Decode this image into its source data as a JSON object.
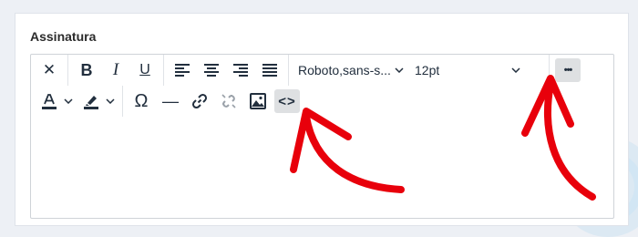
{
  "page": {
    "background_color": "#edf0f5"
  },
  "field": {
    "label": "Assinatura"
  },
  "toolbar": {
    "row1": {
      "clear_formatting": "✕",
      "bold": "B",
      "italic": "I",
      "underline": "U",
      "font_family": "Roboto,sans-s...",
      "font_size": "12pt",
      "more": "•••"
    },
    "row2": {
      "special_char": "Ω",
      "horizontal_line": "—",
      "source_code": "<>"
    }
  },
  "annotation": {
    "arrow_color": "#e8000b"
  },
  "icons": [
    "close-icon",
    "bold-icon",
    "italic-icon",
    "underline-icon",
    "align-left-icon",
    "align-center-icon",
    "align-right-icon",
    "align-justify-icon",
    "chevron-down-icon",
    "more-icon",
    "text-color-icon",
    "highlight-icon",
    "omega-icon",
    "horizontal-line-icon",
    "link-icon",
    "unlink-icon",
    "image-icon",
    "code-icon"
  ]
}
